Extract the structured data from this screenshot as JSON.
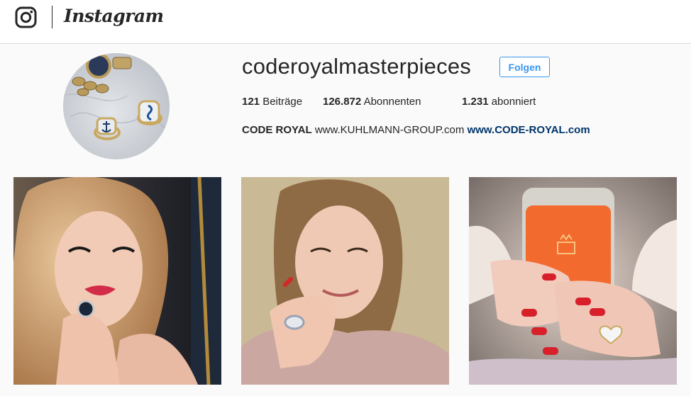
{
  "header": {
    "logo_label": "Instagram"
  },
  "profile": {
    "username": "coderoyalmasterpieces",
    "follow_label": "Folgen",
    "stats": {
      "posts_count": "121",
      "posts_label": "Beiträge",
      "followers_count": "126.872",
      "followers_label": "Abonnenten",
      "following_count": "1.231",
      "following_label": "abonniert"
    },
    "bio": {
      "name": "CODE ROYAL",
      "text": "www.KUHLMANN-GROUP.com",
      "link": "www.CODE-ROYAL.com"
    }
  },
  "posts": [
    {
      "subject": "woman-selfie-ring"
    },
    {
      "subject": "woman-smiling-ring"
    },
    {
      "subject": "hands-phone-red-nails"
    }
  ],
  "colors": {
    "accent": "#3897f0",
    "link": "#003569",
    "phone_case": "#f26a2e",
    "nails": "#d7202a"
  }
}
